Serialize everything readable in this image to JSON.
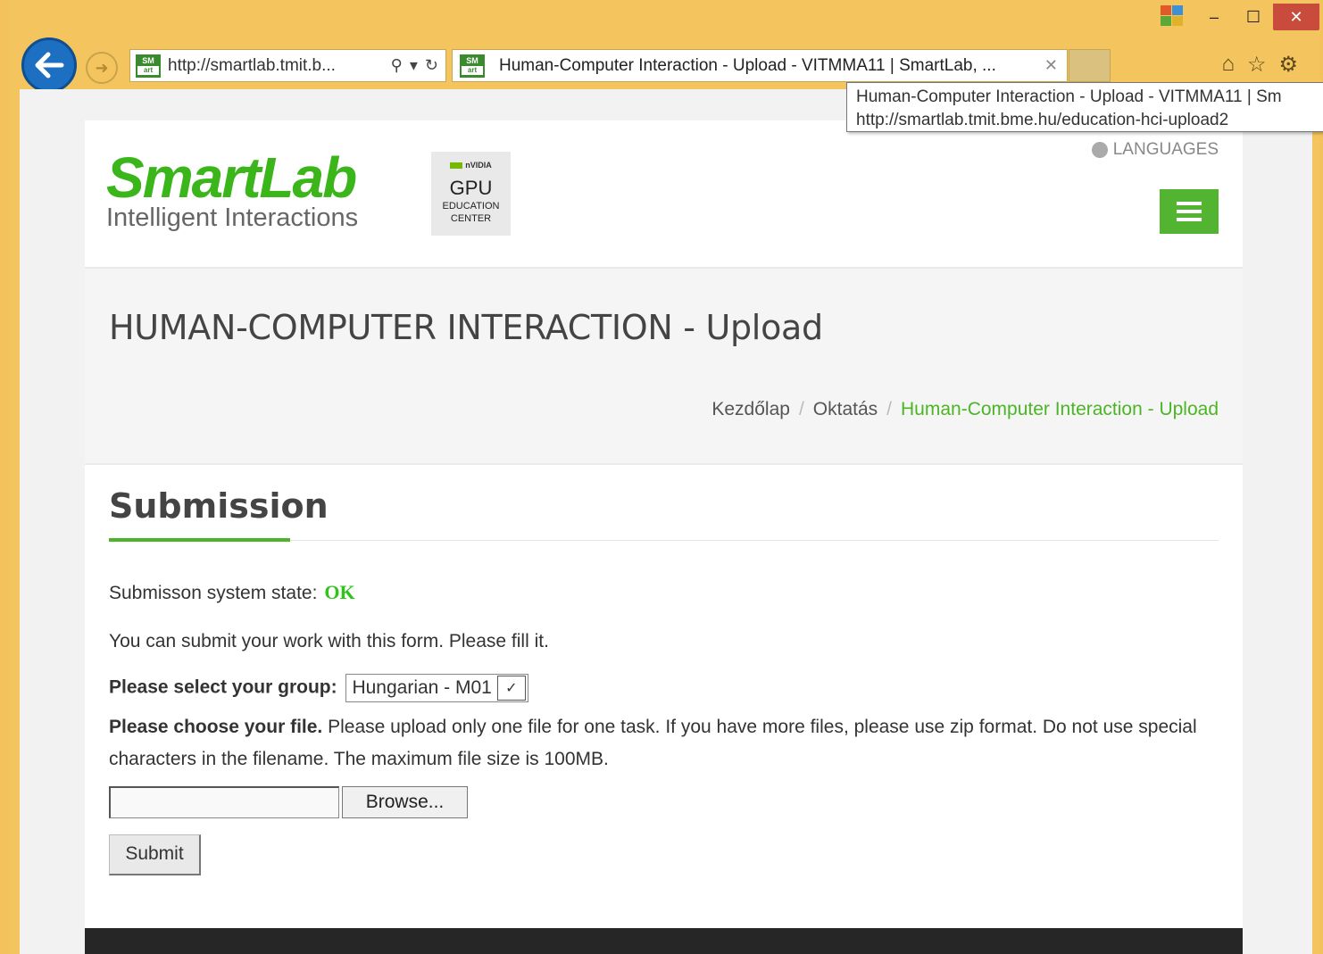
{
  "browser": {
    "address_url": "http://smartlab.tmit.b...",
    "tab_title": "Human-Computer Interaction - Upload - VITMMA11 | SmartLab, ...",
    "site_icon_top": "SM",
    "site_icon_bottom": "art",
    "tooltip_title": "Human-Computer Interaction - Upload - VITMMA11 | Sm",
    "tooltip_url": "http://smartlab.tmit.bme.hu/education-hci-upload2",
    "accent": "#f3c25c"
  },
  "header": {
    "logo_main": "SmartLab",
    "logo_sub": "Intelligent Interactions",
    "badge_brand": "nVIDIA",
    "badge_line1": "GPU",
    "badge_line2": "EDUCATION",
    "badge_line3": "CENTER",
    "languages": "LANGUAGES"
  },
  "titlebar": {
    "title": "HUMAN-COMPUTER INTERACTION - Upload",
    "breadcrumb": [
      "Kezdőlap",
      "Oktatás",
      "Human-Computer Interaction - Upload"
    ]
  },
  "content": {
    "section_title": "Submission",
    "state_label": "Submisson system state:",
    "state_value": "OK",
    "intro": "You can submit your work with this form. Please fill it.",
    "group_label": "Please select your group:",
    "group_selected": "Hungarian - M01",
    "file_label": "Please choose your file.",
    "file_text": " Please upload only one file for one task. If you have more files, please use zip format. Do not use special characters in the filename. The maximum file size is 100MB.",
    "browse_label": "Browse...",
    "submit_label": "Submit"
  },
  "colors": {
    "brand_green": "#3ab51a",
    "ok_green": "#2ec41a"
  }
}
